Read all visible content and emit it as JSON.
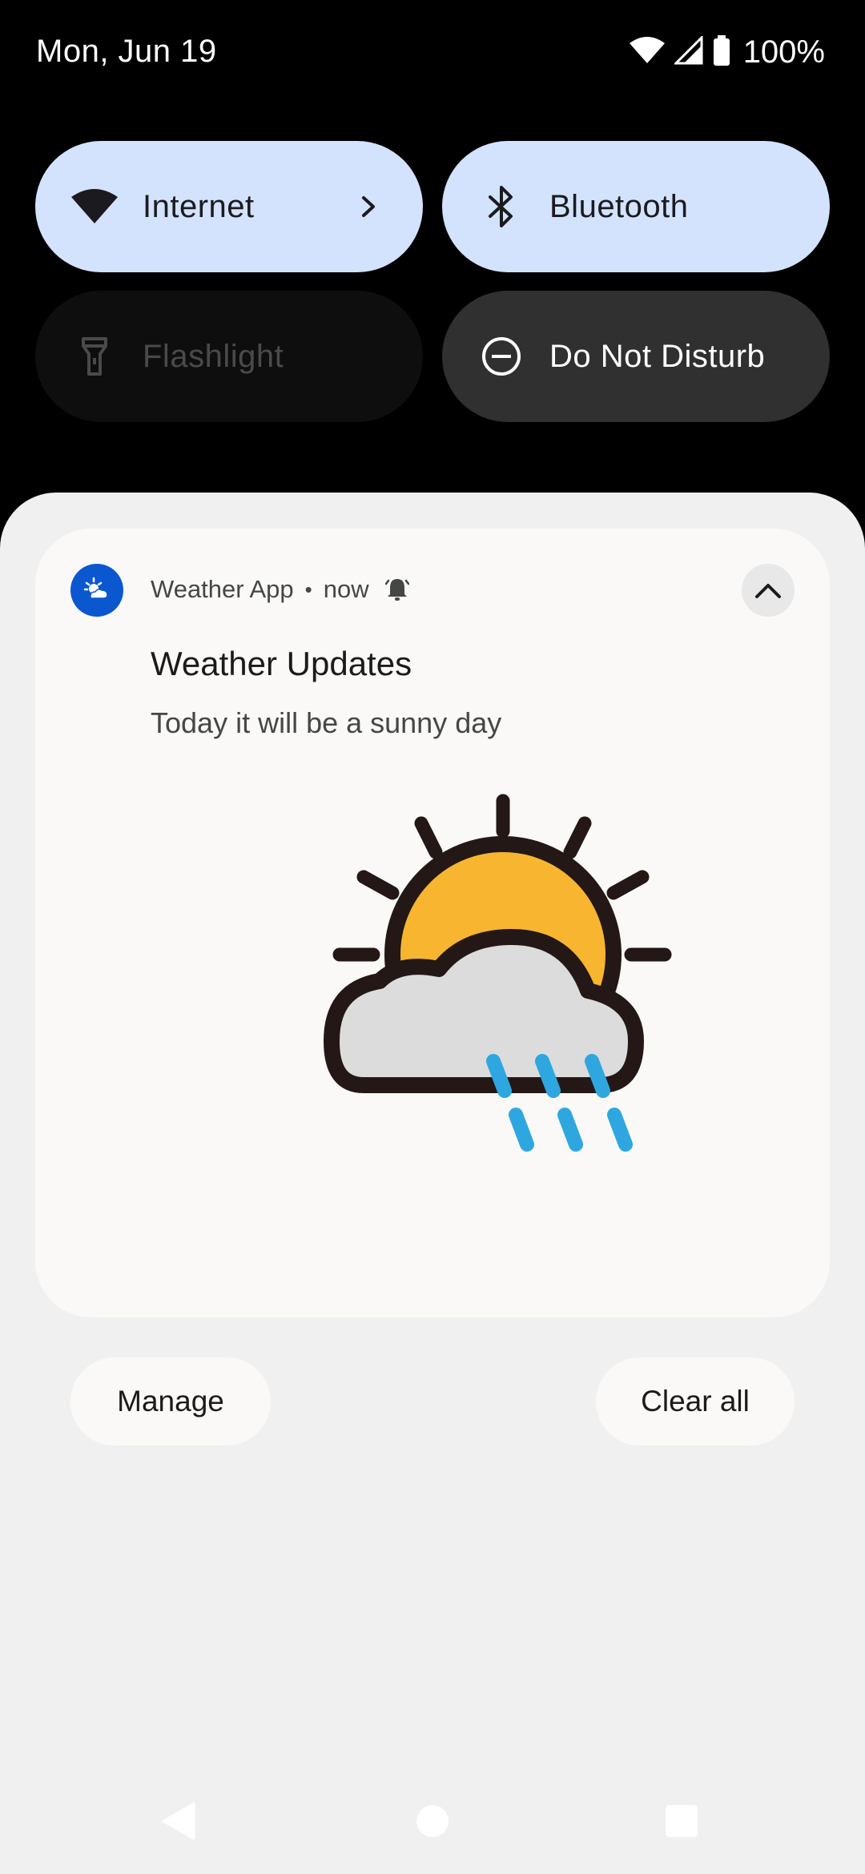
{
  "status_bar": {
    "date": "Mon, Jun 19",
    "battery": "100%",
    "icons": [
      "wifi-icon",
      "cell-signal-icon",
      "battery-icon"
    ]
  },
  "quick_settings": {
    "tiles": [
      {
        "label": "Internet",
        "icon": "wifi-icon",
        "state": "on",
        "has_chevron": true
      },
      {
        "label": "Bluetooth",
        "icon": "bluetooth-icon",
        "state": "on"
      },
      {
        "label": "Flashlight",
        "icon": "flashlight-icon",
        "state": "unavailable"
      },
      {
        "label": "Do Not Disturb",
        "icon": "do-not-disturb-icon",
        "state": "off"
      }
    ]
  },
  "notification": {
    "app_name": "Weather App",
    "separator": "•",
    "time": "now",
    "title": "Weather Updates",
    "text": "Today it will be a sunny day",
    "image": "sun-cloud-rain-icon"
  },
  "actions": {
    "manage": "Manage",
    "clear_all": "Clear all"
  },
  "nav": {
    "buttons": [
      "back-icon",
      "home-icon",
      "recents-icon"
    ]
  },
  "colors": {
    "tile_on": "#d3e3fd",
    "tile_dark": "#303030",
    "app_icon": "#0b57d0",
    "sun": "#f8b52f",
    "rain": "#2ea7e0"
  }
}
